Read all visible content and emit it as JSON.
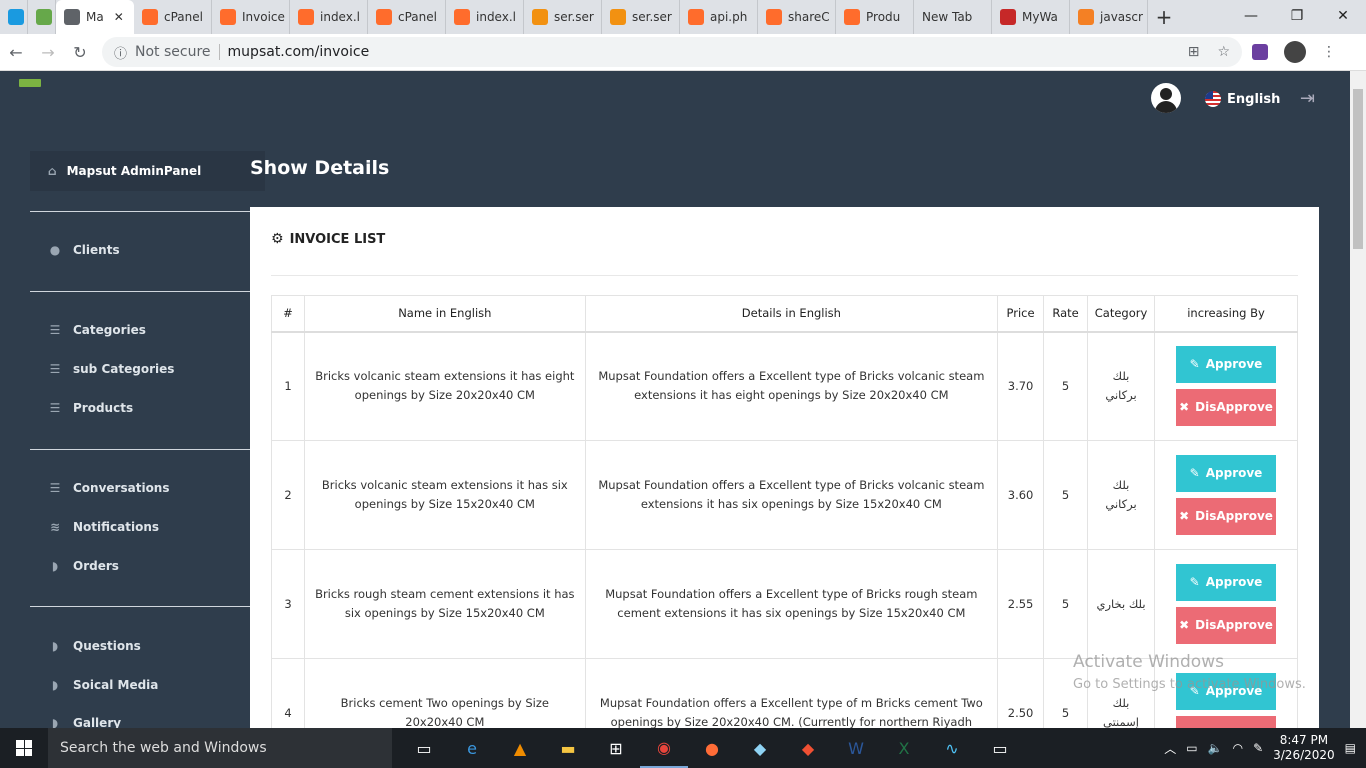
{
  "browser": {
    "tabs": [
      {
        "label": "",
        "icon": "skype-icon",
        "color": "#1a9ae0"
      },
      {
        "label": "",
        "icon": "gmail-icon",
        "color": "#66a84a"
      },
      {
        "label": "Ma",
        "icon": "globe-icon",
        "color": "#5f6368",
        "active": true
      },
      {
        "label": "cPanel",
        "icon": "cpanel-icon",
        "color": "#ff6c2c"
      },
      {
        "label": "Invoice",
        "icon": "cpanel-icon",
        "color": "#ff6c2c"
      },
      {
        "label": "index.l",
        "icon": "cpanel-icon",
        "color": "#ff6c2c"
      },
      {
        "label": "cPanel",
        "icon": "cpanel-icon",
        "color": "#ff6c2c"
      },
      {
        "label": "index.l",
        "icon": "cpanel-icon",
        "color": "#ff6c2c"
      },
      {
        "label": "ser.ser",
        "icon": "phpmyadmin-icon",
        "color": "#f29111"
      },
      {
        "label": "ser.ser",
        "icon": "phpmyadmin-icon",
        "color": "#f29111"
      },
      {
        "label": "api.ph",
        "icon": "cpanel-icon",
        "color": "#ff6c2c"
      },
      {
        "label": "shareC",
        "icon": "cpanel-icon",
        "color": "#ff6c2c"
      },
      {
        "label": "Produ",
        "icon": "cpanel-icon",
        "color": "#ff6c2c"
      },
      {
        "label": "New Tab",
        "icon": "",
        "color": ""
      },
      {
        "label": "MyWa",
        "icon": "mywa-icon",
        "color": "#c62828"
      },
      {
        "label": "javascr",
        "icon": "stackoverflow-icon",
        "color": "#f48024"
      }
    ],
    "security": "Not secure",
    "url": "mupsat.com/invoice"
  },
  "header": {
    "language": "English"
  },
  "sidebar": {
    "top": "Mapsut AdminPanel",
    "groups": [
      [
        "Clients"
      ],
      [
        "Categories",
        "sub Categories",
        "Products"
      ],
      [
        "Conversations",
        "Notifications",
        "Orders"
      ],
      [
        "Questions",
        "Soical Media",
        "Gallery"
      ]
    ]
  },
  "page": {
    "title": "Show Details"
  },
  "card": {
    "title": "INVOICE LIST",
    "columns": [
      "#",
      "Name in English",
      "Details in English",
      "Price",
      "Rate",
      "Category",
      "increasing By"
    ],
    "rows": [
      {
        "num": "1",
        "name": "Bricks volcanic steam extensions it has eight openings by Size 20x20x40 CM",
        "details": "Mupsat Foundation offers a Excellent type of Bricks volcanic steam extensions it has eight openings by Size 20x20x40 CM",
        "price": "3.70",
        "rate": "5",
        "category": "بلك بركاني"
      },
      {
        "num": "2",
        "name": "Bricks volcanic steam extensions it has six openings by Size 15x20x40 CM",
        "details": "Mupsat Foundation offers a Excellent type of Bricks volcanic steam extensions it has six openings by Size 15x20x40 CM",
        "price": "3.60",
        "rate": "5",
        "category": "بلك بركاني"
      },
      {
        "num": "3",
        "name": "Bricks rough steam cement extensions it has six openings by Size 15x20x40 CM",
        "details": "Mupsat Foundation offers a Excellent type of Bricks rough steam cement extensions it has six openings by Size 15x20x40 CM",
        "price": "2.55",
        "rate": "5",
        "category": "بلك بخاري"
      },
      {
        "num": "4",
        "name": "Bricks cement Two openings by Size 20x20x40 CM",
        "details": "Mupsat Foundation offers a Excellent type of m Bricks cement Two openings by Size 20x20x40 CM. (Currently for northern Riyadh",
        "price": "2.50",
        "rate": "5",
        "category": "بلك إسمنتي"
      }
    ],
    "approve_label": "Approve",
    "disapprove_label": "DisApprove"
  },
  "watermark": {
    "line1": "Activate Windows",
    "line2": "Go to Settings to activate Windows."
  },
  "taskbar": {
    "search": "Search the web and Windows",
    "time": "8:47 PM",
    "date": "3/26/2020"
  }
}
